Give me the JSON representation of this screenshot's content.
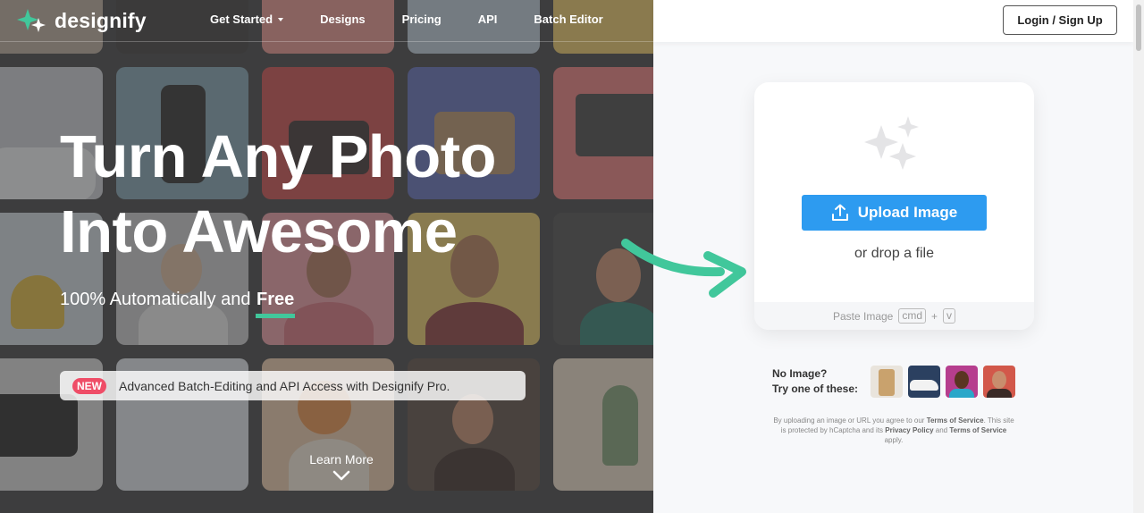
{
  "nav": {
    "logo_text": "designify",
    "links": [
      "Get Started",
      "Designs",
      "Pricing",
      "API",
      "Batch Editor"
    ],
    "login_label": "Login / Sign Up"
  },
  "hero": {
    "headline_line1": "Turn Any Photo",
    "headline_line2": "Into Awesome",
    "sub_prefix": "100% Automatically and ",
    "sub_free": "Free",
    "promo_badge": "NEW",
    "promo_text": "Advanced Batch-Editing and API Access with Designify Pro.",
    "learn_more": "Learn More"
  },
  "upload": {
    "button_label": "Upload Image",
    "drop_text": "or drop a file",
    "paste_label": "Paste Image",
    "kbd_cmd": "cmd",
    "kbd_plus": "+",
    "kbd_v": "v"
  },
  "samples": {
    "line1": "No Image?",
    "line2": "Try one of these:"
  },
  "legal": {
    "part1": "By uploading an image or URL you agree to our ",
    "tos1": "Terms of Service",
    "part2": ". This site is protected by hCaptcha and its ",
    "privacy": "Privacy Policy",
    "part3": " and ",
    "tos2": "Terms of Service",
    "part4": " apply."
  },
  "colors": {
    "accent_green": "#41c79b",
    "upload_blue": "#2d9bf0",
    "badge_red": "#ef4d67"
  }
}
